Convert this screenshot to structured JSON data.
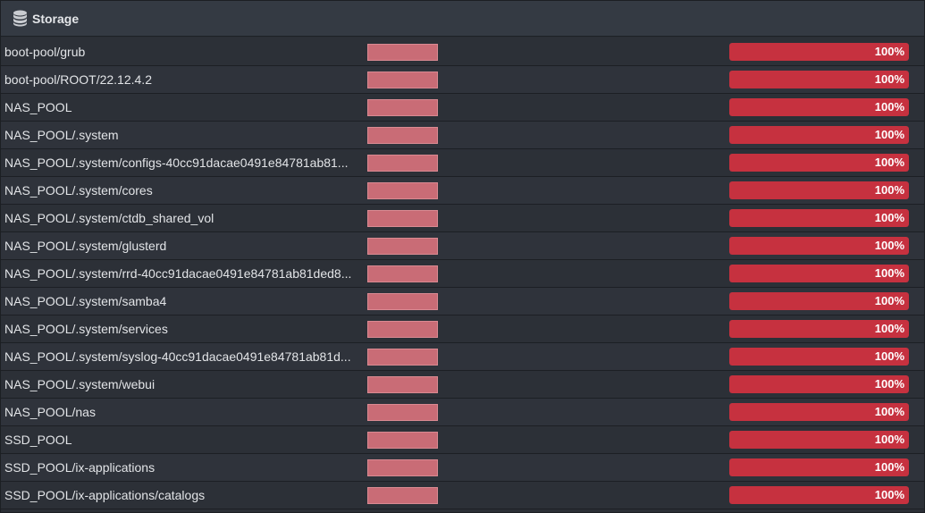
{
  "header": {
    "title": "Storage",
    "icon": "database-icon"
  },
  "colors": {
    "usage_fill": "#c6313f",
    "mini_fill": "#c96c76"
  },
  "datasets": [
    {
      "name": "boot-pool/grub",
      "usage_label": "100%",
      "usage": 1.0
    },
    {
      "name": "boot-pool/ROOT/22.12.4.2",
      "usage_label": "100%",
      "usage": 1.0
    },
    {
      "name": "NAS_POOL",
      "usage_label": "100%",
      "usage": 1.0
    },
    {
      "name": "NAS_POOL/.system",
      "usage_label": "100%",
      "usage": 1.0
    },
    {
      "name": "NAS_POOL/.system/configs-40cc91dacae0491e84781ab81...",
      "usage_label": "100%",
      "usage": 1.0
    },
    {
      "name": "NAS_POOL/.system/cores",
      "usage_label": "100%",
      "usage": 1.0
    },
    {
      "name": "NAS_POOL/.system/ctdb_shared_vol",
      "usage_label": "100%",
      "usage": 1.0
    },
    {
      "name": "NAS_POOL/.system/glusterd",
      "usage_label": "100%",
      "usage": 1.0
    },
    {
      "name": "NAS_POOL/.system/rrd-40cc91dacae0491e84781ab81ded8...",
      "usage_label": "100%",
      "usage": 1.0
    },
    {
      "name": "NAS_POOL/.system/samba4",
      "usage_label": "100%",
      "usage": 1.0
    },
    {
      "name": "NAS_POOL/.system/services",
      "usage_label": "100%",
      "usage": 1.0
    },
    {
      "name": "NAS_POOL/.system/syslog-40cc91dacae0491e84781ab81d...",
      "usage_label": "100%",
      "usage": 1.0
    },
    {
      "name": "NAS_POOL/.system/webui",
      "usage_label": "100%",
      "usage": 1.0
    },
    {
      "name": "NAS_POOL/nas",
      "usage_label": "100%",
      "usage": 1.0
    },
    {
      "name": "SSD_POOL",
      "usage_label": "100%",
      "usage": 1.0
    },
    {
      "name": "SSD_POOL/ix-applications",
      "usage_label": "100%",
      "usage": 1.0
    },
    {
      "name": "SSD_POOL/ix-applications/catalogs",
      "usage_label": "100%",
      "usage": 1.0
    }
  ]
}
